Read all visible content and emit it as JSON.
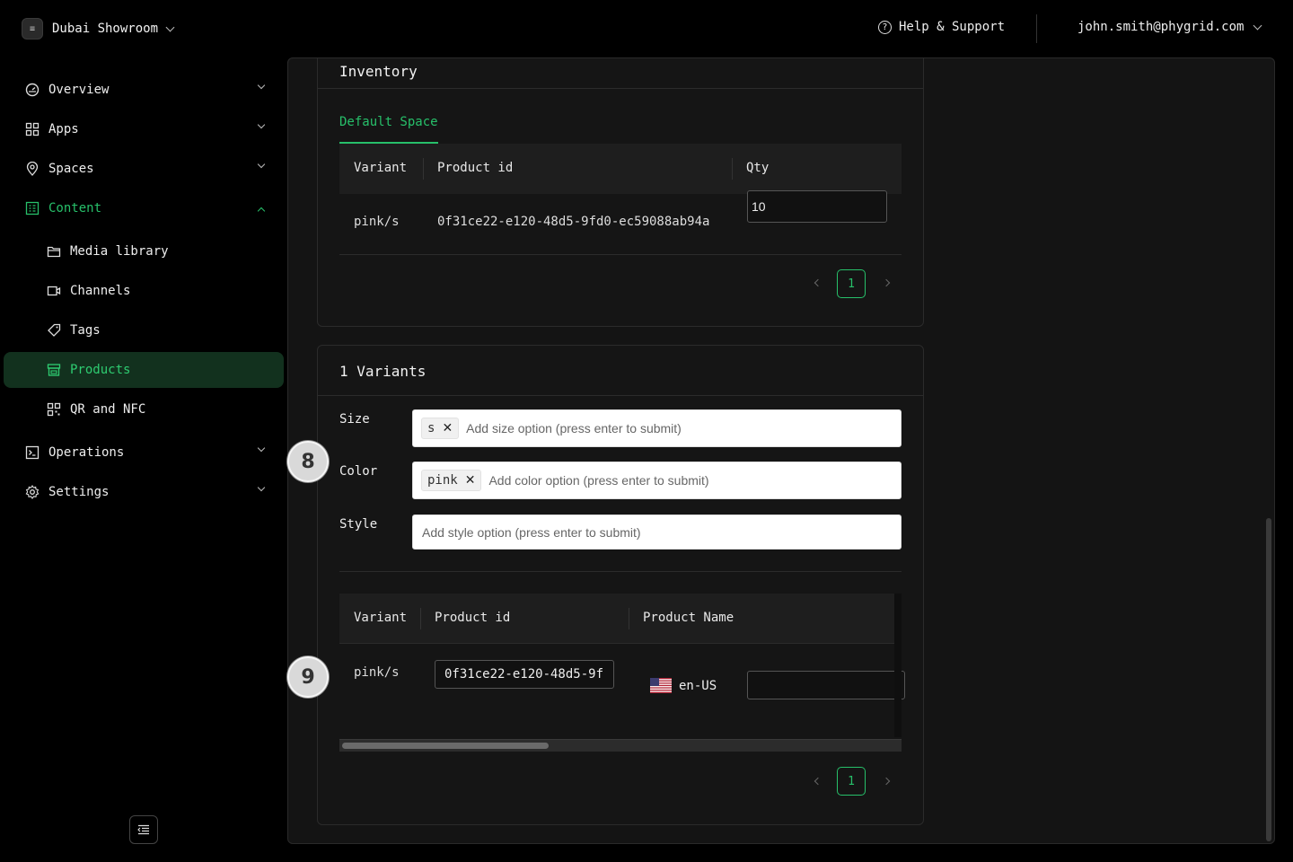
{
  "workspace": {
    "name": "Dubai Showroom",
    "logo_glyph": "≡"
  },
  "header": {
    "help_label": "Help & Support",
    "user_email": "john.smith@phygrid.com"
  },
  "sidebar": {
    "items": [
      {
        "label": "Overview",
        "icon": "gauge-icon"
      },
      {
        "label": "Apps",
        "icon": "grid-icon"
      },
      {
        "label": "Spaces",
        "icon": "location-pin-icon"
      },
      {
        "label": "Content",
        "icon": "content-icon"
      },
      {
        "label": "Media library",
        "icon": "folder-icon"
      },
      {
        "label": "Channels",
        "icon": "video-icon"
      },
      {
        "label": "Tags",
        "icon": "tag-icon"
      },
      {
        "label": "Products",
        "icon": "store-icon"
      },
      {
        "label": "QR and NFC",
        "icon": "qr-code-icon"
      },
      {
        "label": "Operations",
        "icon": "terminal-icon"
      },
      {
        "label": "Settings",
        "icon": "gear-icon"
      }
    ]
  },
  "inventory": {
    "title": "Inventory",
    "tab_label": "Default Space",
    "columns": [
      "Variant",
      "Product id",
      "Qty"
    ],
    "rows": [
      {
        "variant": "pink/s",
        "product_id": "0f31ce22-e120-48d5-9fd0-ec59088ab94a",
        "qty": "10"
      }
    ],
    "page": "1"
  },
  "variants": {
    "title": "1 Variants",
    "options": [
      {
        "label": "Size",
        "tags": [
          "s"
        ],
        "placeholder": "Add size option (press enter to submit)"
      },
      {
        "label": "Color",
        "tags": [
          "pink"
        ],
        "placeholder": "Add color option (press enter to submit)"
      },
      {
        "label": "Style",
        "tags": [],
        "placeholder": "Add style option (press enter to submit)"
      }
    ],
    "columns": [
      "Variant",
      "Product id",
      "Product Name"
    ],
    "rows": [
      {
        "variant": "pink/s",
        "product_id": "0f31ce22-e120-48d5-9f",
        "locale": "en-US",
        "product_name": ""
      }
    ],
    "page": "1"
  },
  "badges": [
    "8",
    "9"
  ],
  "colors": {
    "accent": "#27c06a",
    "active_bg": "#12311e"
  }
}
